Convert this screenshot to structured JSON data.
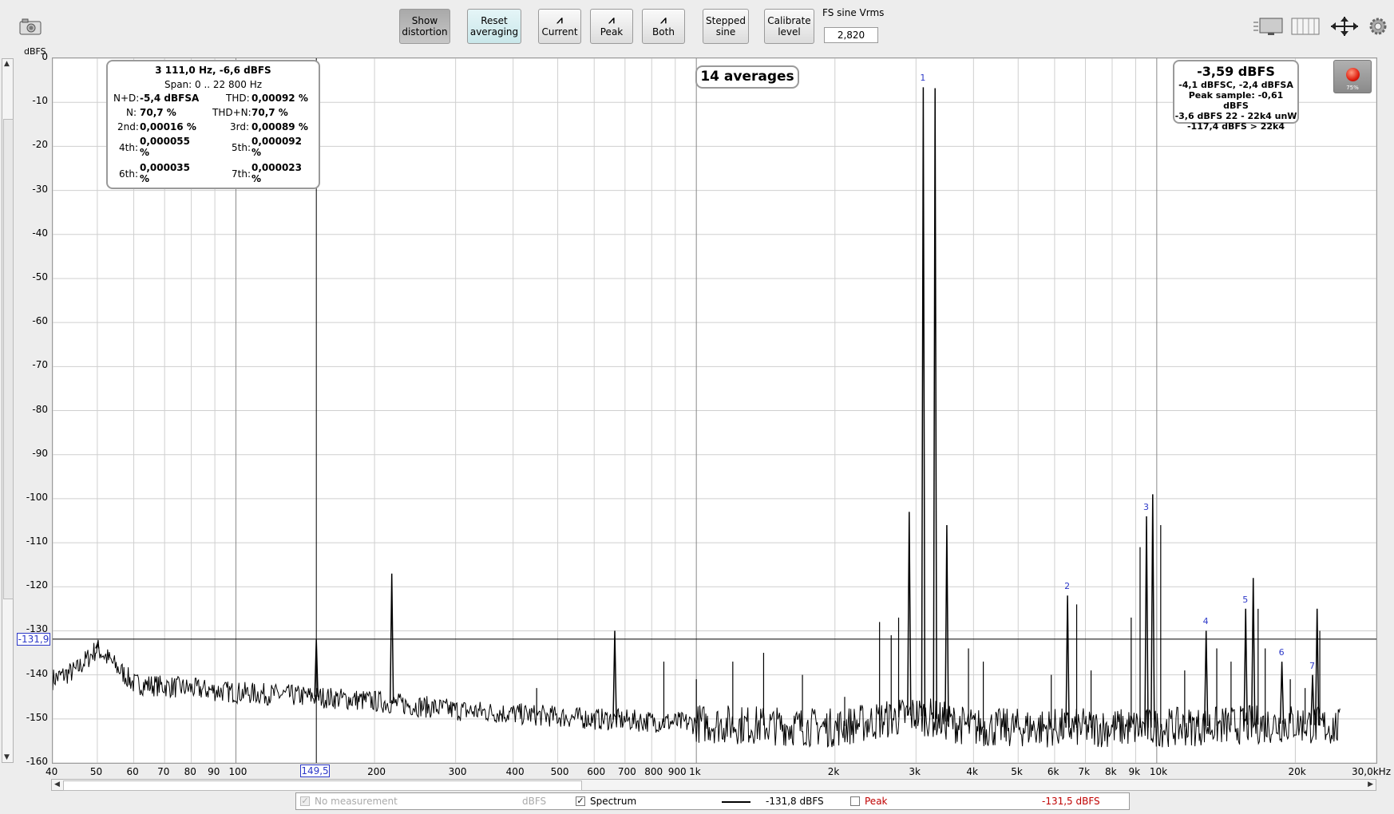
{
  "toolbar": {
    "buttons": [
      {
        "label_line1": "Show",
        "label_line2": "distortion"
      },
      {
        "label_line1": "Reset",
        "label_line2": "averaging"
      },
      {
        "label": "Current"
      },
      {
        "label": "Peak"
      },
      {
        "label": "Both"
      },
      {
        "label_line1": "Stepped",
        "label_line2": "sine"
      },
      {
        "label_line1": "Calibrate",
        "label_line2": "level"
      }
    ],
    "fs_label": "FS sine Vrms",
    "fs_value": "2,820",
    "icons": [
      "camera-icon",
      "layout-icon",
      "grid-columns-icon",
      "fit-arrows-icon",
      "gear-icon"
    ]
  },
  "plot": {
    "y_unit": "dBFS",
    "y_ticks": [
      "0",
      "-10",
      "-20",
      "-30",
      "-40",
      "-50",
      "-60",
      "-70",
      "-80",
      "-90",
      "-100",
      "-110",
      "-120",
      "-130",
      "-140",
      "-150",
      "-160"
    ],
    "x_ticks": [
      "40",
      "50",
      "60",
      "70",
      "80",
      "90",
      "100",
      "200",
      "300",
      "400",
      "500",
      "600",
      "700",
      "800",
      "900",
      "1k",
      "2k",
      "3k",
      "4k",
      "5k",
      "6k",
      "7k",
      "8k",
      "9k",
      "10k",
      "20k",
      "30,0kHz"
    ],
    "cursor_x_label": "149,5",
    "cursor_y_label": "-131,9",
    "averages": "14 averages",
    "harmonic_labels": [
      "1",
      "2",
      "3",
      "4",
      "5",
      "6",
      "7"
    ]
  },
  "chart_data": {
    "type": "line",
    "title": "",
    "xlabel": "",
    "ylabel": "dBFS",
    "x_scale": "log",
    "xlim": [
      40,
      30000
    ],
    "ylim": [
      -160,
      0
    ],
    "grid": true,
    "series": [
      {
        "name": "Spectrum",
        "noise_floor_dbfs": [
          [
            40,
            -141
          ],
          [
            45,
            -139
          ],
          [
            50,
            -134
          ],
          [
            60,
            -142
          ],
          [
            100,
            -144
          ],
          [
            150,
            -145
          ],
          [
            200,
            -146
          ],
          [
            300,
            -148
          ],
          [
            600,
            -150
          ],
          [
            1000,
            -151
          ],
          [
            2000,
            -152
          ],
          [
            3000,
            -149
          ],
          [
            4000,
            -152
          ],
          [
            10000,
            -152
          ],
          [
            20000,
            -151
          ],
          [
            25000,
            -152
          ]
        ],
        "peaks": [
          {
            "freq_hz": 3111,
            "dbfs": -6.6,
            "label": "1"
          },
          {
            "freq_hz": 3300,
            "dbfs": -6.8
          },
          {
            "freq_hz": 6400,
            "dbfs": -122,
            "label": "2"
          },
          {
            "freq_hz": 9500,
            "dbfs": -104,
            "label": "3"
          },
          {
            "freq_hz": 9800,
            "dbfs": -99
          },
          {
            "freq_hz": 12800,
            "dbfs": -130,
            "label": "4"
          },
          {
            "freq_hz": 15600,
            "dbfs": -125,
            "label": "5"
          },
          {
            "freq_hz": 16200,
            "dbfs": -118
          },
          {
            "freq_hz": 18700,
            "dbfs": -137,
            "label": "6"
          },
          {
            "freq_hz": 21800,
            "dbfs": -140,
            "label": "7"
          },
          {
            "freq_hz": 22300,
            "dbfs": -125
          },
          {
            "freq_hz": 50,
            "dbfs": -133
          },
          {
            "freq_hz": 149.5,
            "dbfs": -132
          },
          {
            "freq_hz": 218,
            "dbfs": -117
          },
          {
            "freq_hz": 665,
            "dbfs": -130
          },
          {
            "freq_hz": 2900,
            "dbfs": -103
          },
          {
            "freq_hz": 3500,
            "dbfs": -106
          }
        ]
      }
    ]
  },
  "info": {
    "header": "3 111,0 Hz, -6,6 dBFS",
    "span": "Span:  0 .. 22 800 Hz",
    "nd_label": "N+D:",
    "nd_value": "-5,4 dBFSA",
    "thd_label": "THD:",
    "thd_value": "0,00092 %",
    "n_label": "N:",
    "n_value": "70,7 %",
    "thdn_label": "THD+N:",
    "thdn_value": "70,7 %",
    "h2_label": "2nd:",
    "h2_value": "0,00016 %",
    "h3_label": "3rd:",
    "h3_value": "0,00089 %",
    "h4_label": "4th:",
    "h4_value_a": "0,000055",
    "h4_value_b": "%",
    "h5_label": "5th:",
    "h5_value_a": "0,000092",
    "h5_value_b": "%",
    "h6_label": "6th:",
    "h6_value_a": "0,000035",
    "h6_value_b": "%",
    "h7_label": "7th:",
    "h7_value_a": "0,000023",
    "h7_value_b": "%"
  },
  "level": {
    "main": "-3,59 dBFS",
    "line2": "-4,1 dBFSC, -2,4 dBFSA",
    "line3": "Peak sample: -0,61 dBFS",
    "line4": "-3,6 dBFS 22 - 22k4 unW",
    "line5": "-117,4 dBFS > 22k4",
    "rec_pct": "75%"
  },
  "legend": {
    "no_measurement": "No measurement",
    "no_measurement_unit": "dBFS",
    "spectrum": "Spectrum",
    "spectrum_value": "-131,8 dBFS",
    "peak": "Peak",
    "peak_value": "-131,5 dBFS",
    "colors": {
      "spectrum": "#000000",
      "peak": "#c00000"
    }
  }
}
